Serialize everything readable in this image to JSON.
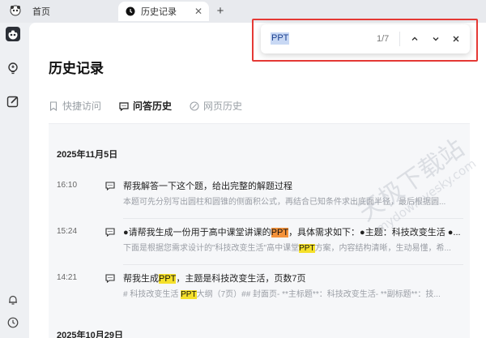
{
  "tabs": [
    {
      "label": "首页",
      "icon": "panda-logo-icon"
    },
    {
      "label": "历史记录",
      "icon": "clock-icon",
      "close_icon": "close-icon"
    }
  ],
  "new_tab_icon": "plus-icon",
  "rail": {
    "top_logo": "panda-logo-icon",
    "items": [
      "lightbulb-icon",
      "edit-icon"
    ],
    "bottom_items": [
      "bell-icon",
      "clock-icon"
    ]
  },
  "page": {
    "title": "历史记录",
    "subtabs": [
      {
        "label": "快捷访问",
        "icon": "bookmark-icon",
        "active": false
      },
      {
        "label": "问答历史",
        "icon": "chat-icon",
        "active": true
      },
      {
        "label": "网页历史",
        "icon": "link-icon",
        "active": false
      }
    ]
  },
  "history": {
    "groups": [
      {
        "date": "2025年11月5日",
        "items": [
          {
            "time": "16:10",
            "title": "帮我解答一下这个题，给出完整的解题过程",
            "snippet": "本题可先分别写出圆柱和圆锥的侧面积公式，再结合已知条件求出底面半径，最后根据圆..."
          },
          {
            "time": "15:24",
            "title_pre": "●请帮我生成一份用于高中课堂讲课的",
            "title_hl": "PPT",
            "title_post": "，具体需求如下：●主题：科技改变生活 ●...",
            "snippet_pre": "下面是根据您需求设计的\"科技改变生活\"高中课堂",
            "snippet_hl": "PPT",
            "snippet_post": "方案，内容结构清晰，生动易懂，希..."
          },
          {
            "time": "14:21",
            "title_pre": "帮我生成",
            "title_hl": "PPT",
            "title_post": "，主题是科技改变生活，页数7页",
            "snippet_pre": "# 科技改变生活 ",
            "snippet_hl": "PPT",
            "snippet_post": "大纲（7页）## 封面页- **主标题**：科技改变生活- **副标题**：技..."
          }
        ]
      },
      {
        "date": "2025年10月29日",
        "items": []
      }
    ]
  },
  "find_bar": {
    "query": "PPT",
    "count": "1/7",
    "prev_icon": "chevron-up-icon",
    "next_icon": "chevron-down-icon",
    "close_icon": "close-icon"
  },
  "watermark": {
    "text": "天极下载站",
    "sub": "mydown.yesky.com"
  },
  "colors": {
    "highlight": "#f5e02a",
    "current_highlight": "#f4923a",
    "annotation_border": "#e53935"
  }
}
